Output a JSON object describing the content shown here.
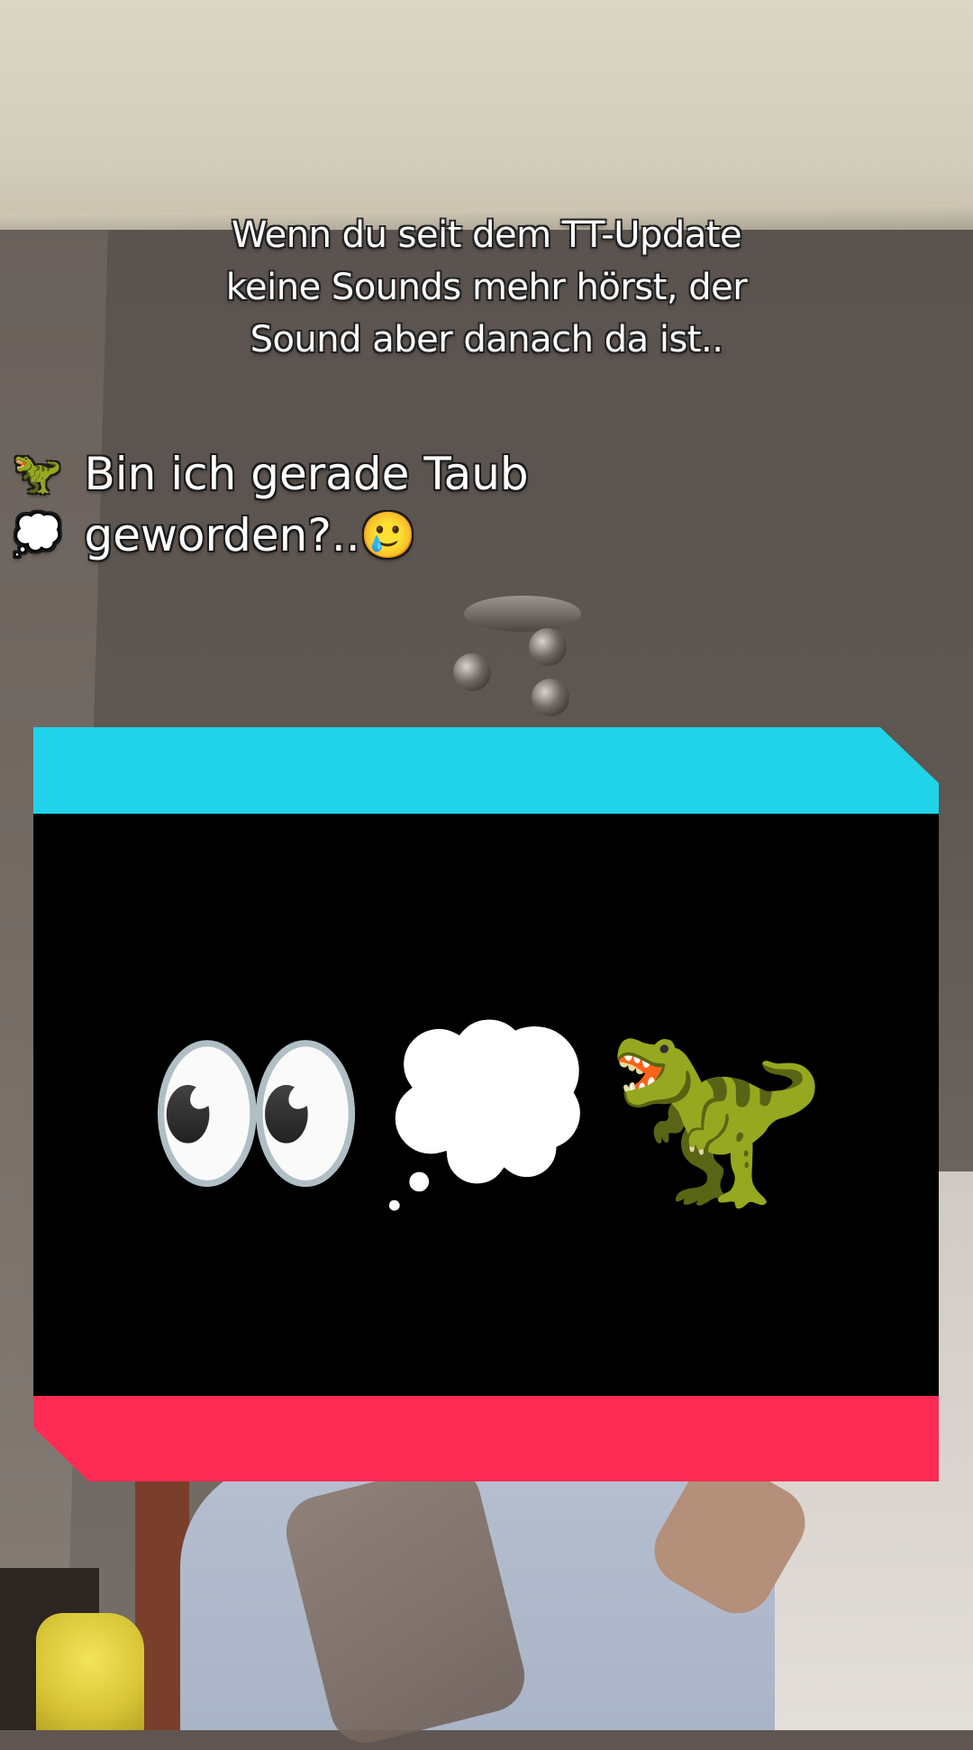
{
  "overlay_caption": {
    "text": "Wenn du seit dem TT-Update keine Sounds mehr hörst, der Sound aber danach da ist.."
  },
  "main_caption": {
    "prefix_emojis": "🦖💭",
    "text": "Bin ich gerade Taub geworden?..🥲"
  },
  "card": {
    "emojis": [
      "👀",
      "💭",
      "🦖"
    ],
    "colors": {
      "top_band": "#20d3e9",
      "bottom_band": "#fe2c55",
      "body": "#000000"
    }
  }
}
